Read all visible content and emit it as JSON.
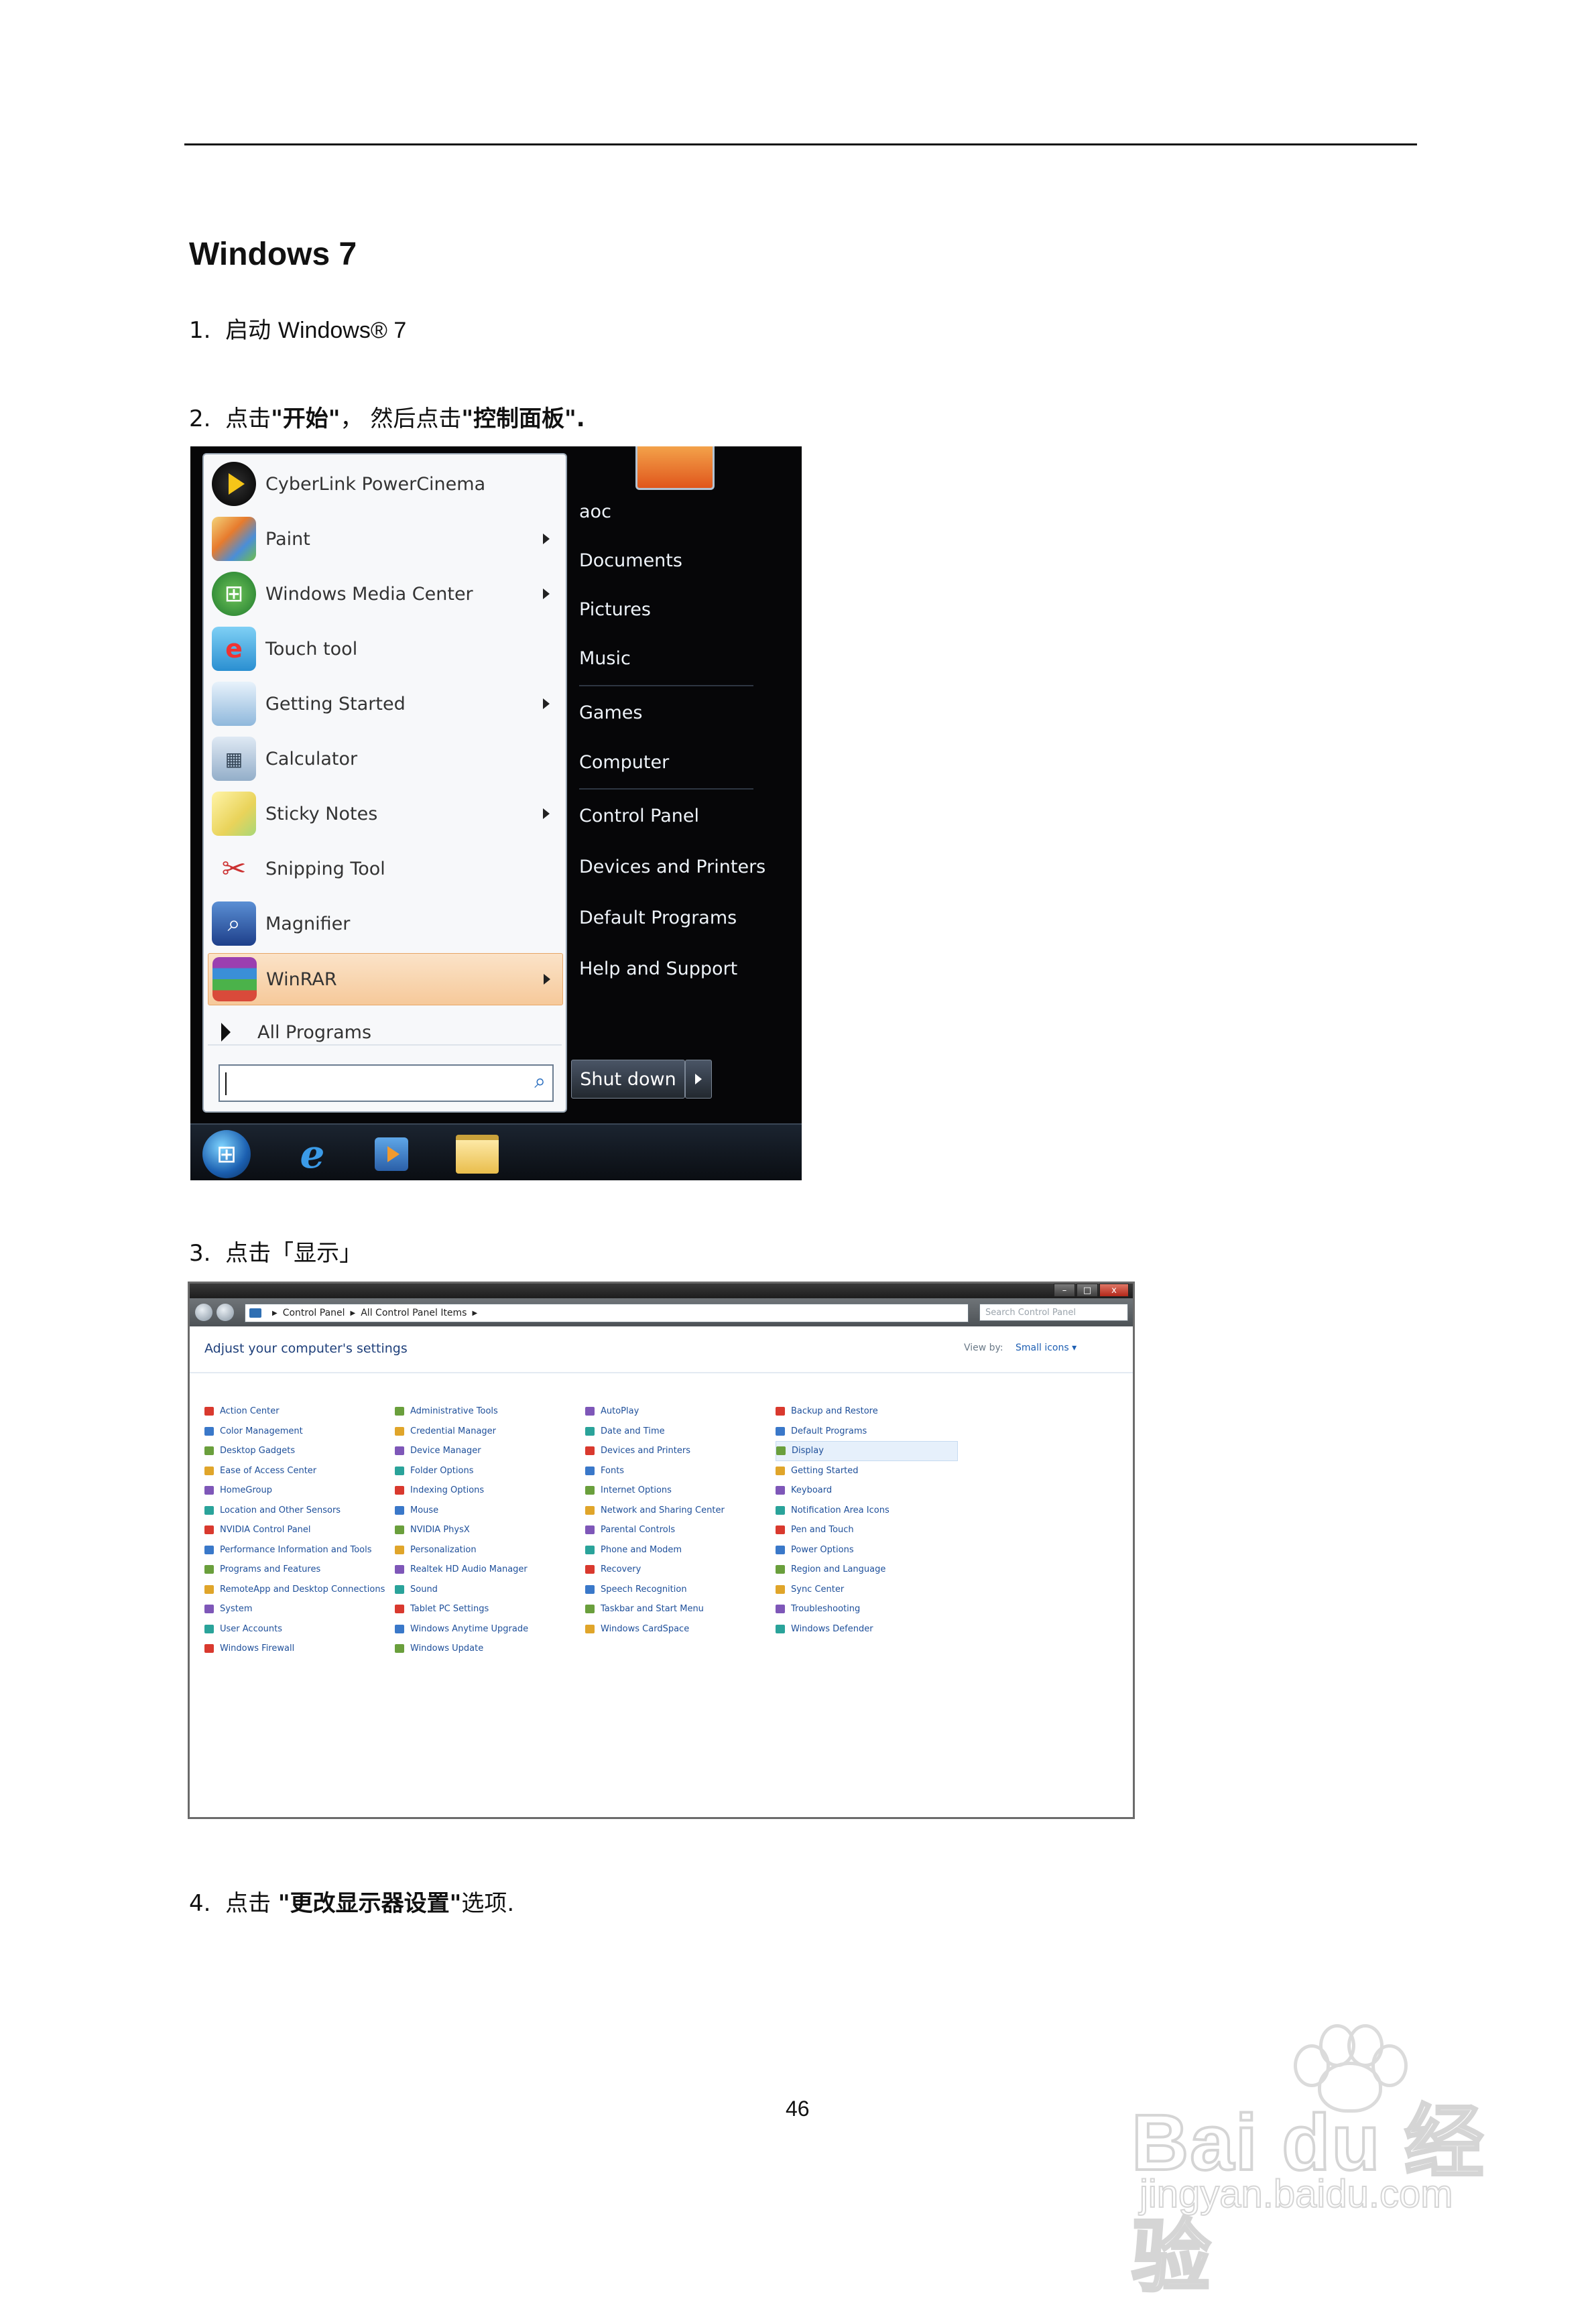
{
  "document": {
    "title": "Windows 7",
    "steps": [
      {
        "number": "1.",
        "text_prefix": "启动 ",
        "text_main": "Windows® 7",
        "text_suffix": ""
      },
      {
        "number": "2.",
        "text_prefix": "点击",
        "text_bold1": "\"开始\"",
        "text_mid": "，  然后点击",
        "text_bold2": "\"控制面板\".",
        "text_suffix": ""
      },
      {
        "number": "3.",
        "text_prefix": "点击「显示」"
      },
      {
        "number": "4.",
        "text_prefix": "点击  ",
        "text_bold": "\"更改显示器设置\"",
        "text_suffix": "选项."
      }
    ],
    "page_number": "46"
  },
  "start_menu": {
    "programs": [
      {
        "label": "CyberLink PowerCinema",
        "icon": "cyberlink-icon",
        "submenu": false
      },
      {
        "label": "Paint",
        "icon": "paint-icon",
        "submenu": true
      },
      {
        "label": "Windows Media Center",
        "icon": "media-center-icon",
        "submenu": true
      },
      {
        "label": "Touch tool",
        "icon": "touch-tool-icon",
        "submenu": false
      },
      {
        "label": "Getting Started",
        "icon": "getting-started-icon",
        "submenu": true
      },
      {
        "label": "Calculator",
        "icon": "calculator-icon",
        "submenu": false
      },
      {
        "label": "Sticky Notes",
        "icon": "sticky-notes-icon",
        "submenu": true
      },
      {
        "label": "Snipping Tool",
        "icon": "snipping-tool-icon",
        "submenu": false
      },
      {
        "label": "Magnifier",
        "icon": "magnifier-icon",
        "submenu": false
      },
      {
        "label": "WinRAR",
        "icon": "winrar-icon",
        "submenu": true,
        "highlighted": true
      }
    ],
    "all_programs": "All Programs",
    "search_placeholder": "",
    "right_items": [
      "aoc",
      "Documents",
      "Pictures",
      "Music",
      "Games",
      "Computer",
      "Control Panel",
      "Devices and Printers",
      "Default Programs",
      "Help and Support"
    ],
    "shutdown_label": "Shut down"
  },
  "control_panel": {
    "window_buttons": [
      "–",
      "□",
      "x"
    ],
    "breadcrumb": [
      "Control Panel",
      "All Control Panel Items"
    ],
    "search_placeholder": "Search Control Panel",
    "heading": "Adjust your computer's settings",
    "view_by_label": "View by:",
    "view_by_value": "Small icons ▾",
    "columns": [
      [
        "Action Center",
        "Color Management",
        "Desktop Gadgets",
        "Ease of Access Center",
        "HomeGroup",
        "Location and Other Sensors",
        "NVIDIA Control Panel",
        "Performance Information and Tools",
        "Programs and Features",
        "RemoteApp and Desktop Connections",
        "System",
        "User Accounts",
        "Windows Firewall"
      ],
      [
        "Administrative Tools",
        "Credential Manager",
        "Device Manager",
        "Folder Options",
        "Indexing Options",
        "Mouse",
        "NVIDIA PhysX",
        "Personalization",
        "Realtek HD Audio Manager",
        "Sound",
        "Tablet PC Settings",
        "Windows Anytime Upgrade",
        "Windows Update"
      ],
      [
        "AutoPlay",
        "Date and Time",
        "Devices and Printers",
        "Fonts",
        "Internet Options",
        "Network and Sharing Center",
        "Parental Controls",
        "Phone and Modem",
        "Recovery",
        "Speech Recognition",
        "Taskbar and Start Menu",
        "Windows CardSpace"
      ],
      [
        "Backup and Restore",
        "Default Programs",
        "Display",
        "Getting Started",
        "Keyboard",
        "Notification Area Icons",
        "Pen and Touch",
        "Power Options",
        "Region and Language",
        "Sync Center",
        "Troubleshooting",
        "Windows Defender"
      ]
    ],
    "selected_item": "Display",
    "icon_colors": [
      "#d9392e",
      "#3a78c9",
      "#6a9f3c",
      "#e0a52a",
      "#7e57b8",
      "#2aa39a"
    ]
  },
  "watermark": {
    "brand": "Bai du 经验",
    "url": "jingyan.baidu.com"
  }
}
